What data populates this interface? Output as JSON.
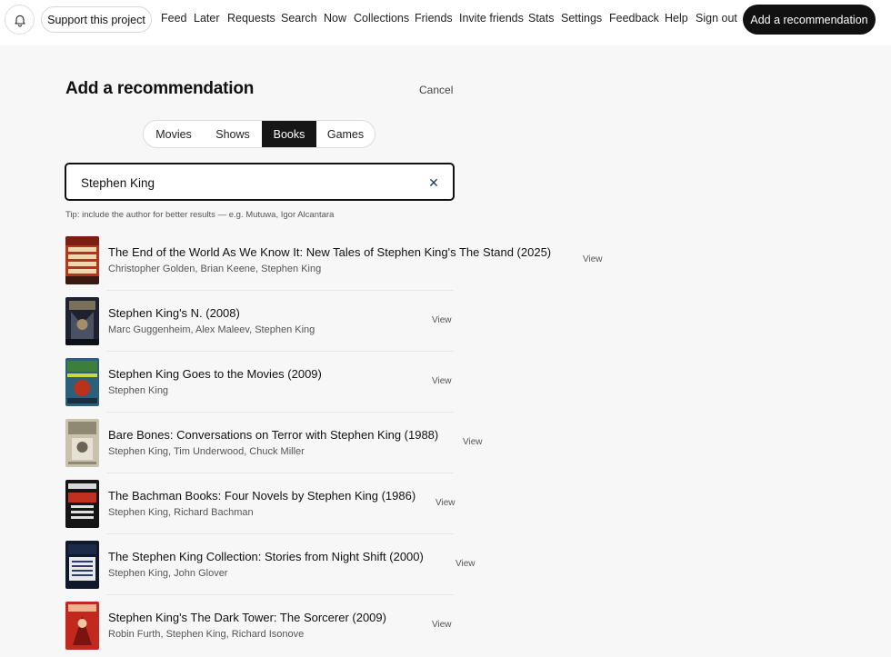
{
  "nav": {
    "bell_icon": "bell-icon",
    "support_label": "Support this project",
    "links": [
      "Feed",
      "Later",
      "Requests",
      "Search",
      "Now",
      "Collections",
      "Friends",
      "Invite friends",
      "Stats",
      "Settings",
      "Feedback",
      "Help",
      "Sign out"
    ],
    "add_recommendation_label": "Add a recommendation"
  },
  "header": {
    "title": "Add a recommendation",
    "cancel_label": "Cancel"
  },
  "tabs": {
    "items": [
      "Movies",
      "Shows",
      "Books",
      "Games"
    ],
    "active": "Books"
  },
  "search": {
    "value": "Stephen King",
    "clear_icon": "close-icon",
    "tip": "Tip: include the author for better results — e.g. Mutuwa, Igor Alcantara"
  },
  "results": [
    {
      "title": "The End of the World As We Know It: New Tales of Stephen King's The Stand (2025)",
      "authors": "Christopher Golden, Brian Keene, Stephen King",
      "action": "View"
    },
    {
      "title": "Stephen King's N. (2008)",
      "authors": "Marc Guggenheim, Alex Maleev, Stephen King",
      "action": "View"
    },
    {
      "title": "Stephen King Goes to the Movies (2009)",
      "authors": "Stephen King",
      "action": "View"
    },
    {
      "title": "Bare Bones: Conversations on Terror with Stephen King (1988)",
      "authors": "Stephen King, Tim Underwood, Chuck Miller",
      "action": "View"
    },
    {
      "title": "The Bachman Books: Four Novels by Stephen King (1986)",
      "authors": "Stephen King, Richard Bachman",
      "action": "View"
    },
    {
      "title": "The Stephen King Collection: Stories from Night Shift (2000)",
      "authors": "Stephen King, John Glover",
      "action": "View"
    },
    {
      "title": "Stephen King's The Dark Tower: The Sorcerer (2009)",
      "authors": "Robin Furth, Stephen King, Richard Isonove",
      "action": "View"
    }
  ],
  "colors": {
    "background": "#f7f7f7",
    "primary_button": "#111111",
    "clear_icon": "#1c3a6b"
  }
}
